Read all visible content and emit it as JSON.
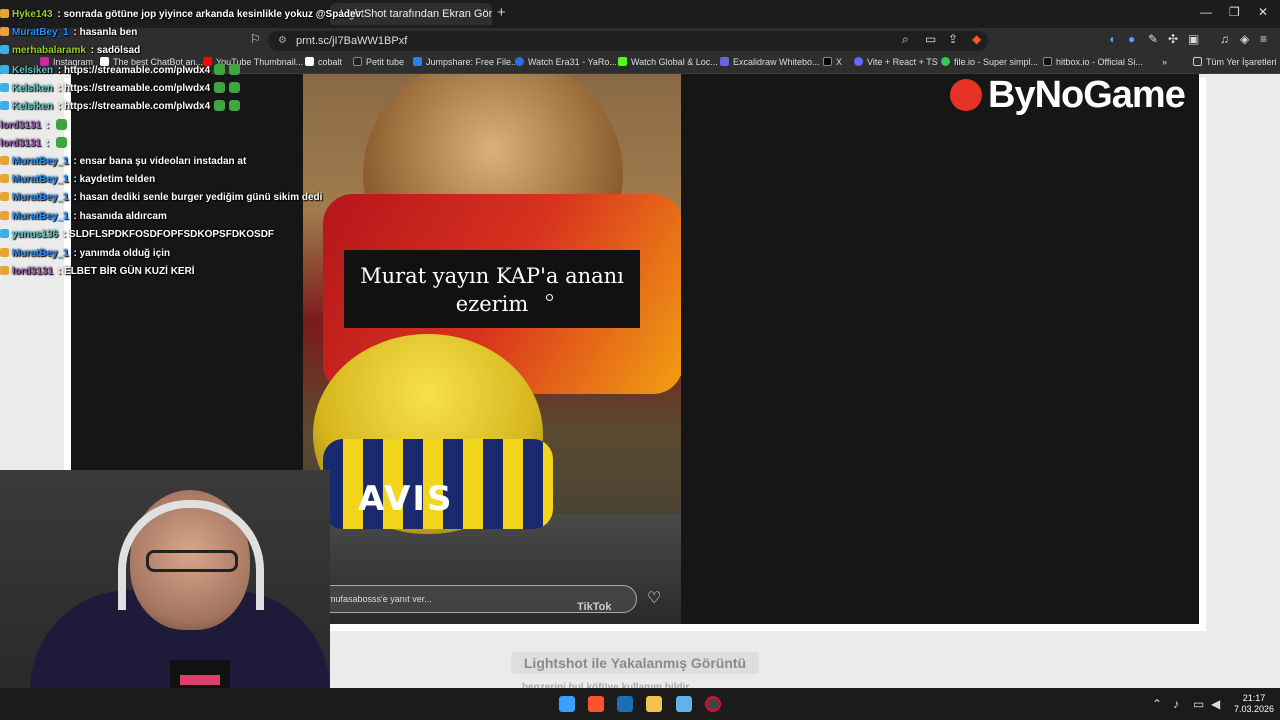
{
  "browser": {
    "tabs": [
      {
        "label": "LightShot tarafından Ekran Görü",
        "active": true
      }
    ],
    "url": "prnt.sc/jI7BaWW1BPxf",
    "bookmarks": [
      {
        "label": "Instagram",
        "color": "#d6249f"
      },
      {
        "label": "The best ChatBot an...",
        "color": "#ffffff"
      },
      {
        "label": "YouTube Thumbnail...",
        "color": "#ff0000"
      },
      {
        "label": "cobalt",
        "color": "#ffffff"
      },
      {
        "label": "Petit tube",
        "color": "#222222"
      },
      {
        "label": "Jumpshare: Free File...",
        "color": "#2f80ed"
      },
      {
        "label": "Watch Era31 - YaRo...",
        "color": "#2d6ee0"
      },
      {
        "label": "Watch Global & Loc...",
        "color": "#53fc18"
      },
      {
        "label": "Excalidraw Whitebo...",
        "color": "#6965db"
      },
      {
        "label": "X",
        "color": "#000000"
      },
      {
        "label": "Vite + React + TS",
        "color": "#646cff"
      },
      {
        "label": "file.io - Super simpl...",
        "color": "#34c759"
      },
      {
        "label": "hitbox.io - Official Si...",
        "color": "#111111"
      },
      {
        "label": "Tüm Yer İşaretleri",
        "color": "#ffffff"
      }
    ]
  },
  "page": {
    "brand": "ByNoGame",
    "caption_line1": "Murat yayın KAP'a ananı",
    "caption_line2": "ezerim",
    "jersey_text": "AVIS",
    "reply_placeholder": "mufasabosss'e yanıt ver...",
    "tiktok_label": "TikTok",
    "lightshot_badge": "Lightshot ile Yakalanmış Görüntü",
    "lightshot_note": "benzerini bul   köfüye kullanım bildir"
  },
  "chat": [
    {
      "user": "Hyke143",
      "user_color": "#9acd32",
      "text": "sonrada götüne jop yiyince arkanda kesinlikle yokuz @Spadev"
    },
    {
      "user": "MuratBey_1",
      "user_color": "#1e90ff",
      "text": "hasanla ben"
    },
    {
      "user": "merhabalaramk",
      "user_color": "#9acd32",
      "text": "sadölsad"
    },
    {
      "user": "Kelsiken",
      "user_color": "#5fc0c0",
      "text": "https://streamable.com/plwdx4"
    },
    {
      "user": "Kelsiken",
      "user_color": "#5fc0c0",
      "text": "https://streamable.com/plwdx4"
    },
    {
      "user": "Kelsiken",
      "user_color": "#5fc0c0",
      "text": "https://streamable.com/plwdx4"
    },
    {
      "user": "lord3131",
      "user_color": "#9b59b6",
      "text": ""
    },
    {
      "user": "lord3131",
      "user_color": "#9b59b6",
      "text": ""
    },
    {
      "user": "MuratBey_1",
      "user_color": "#1e90ff",
      "text": "ensar bana şu videoları instadan at"
    },
    {
      "user": "MuratBey_1",
      "user_color": "#1e90ff",
      "text": "kaydetim telden"
    },
    {
      "user": "MuratBey_1",
      "user_color": "#1e90ff",
      "text": "hasan dediki senle burger yediğim günü sikim dedi"
    },
    {
      "user": "MuratBey_1",
      "user_color": "#1e90ff",
      "text": "hasanıda aldırcam"
    },
    {
      "user": "yunus136",
      "user_color": "#5fc0c0",
      "text": "SLDFLSPDKFOSDFOPFSDKOPSFDKOSDF"
    },
    {
      "user": "MuratBey_1",
      "user_color": "#1e90ff",
      "text": "yanımda olduğ için"
    },
    {
      "user": "lord3131",
      "user_color": "#9b59b6",
      "text": "ELBET BİR GÜN KUZİ KERİ"
    }
  ],
  "taskbar": {
    "time": "21:17",
    "date": "7.03.2026"
  }
}
